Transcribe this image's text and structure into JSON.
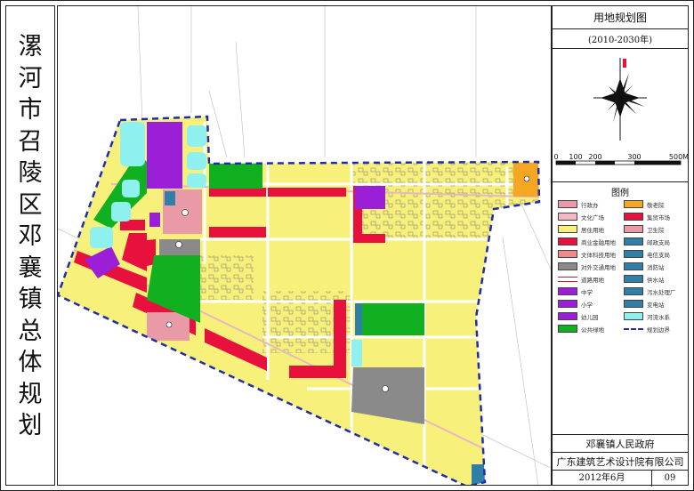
{
  "title_chars": [
    "漯",
    "河",
    "市",
    "召",
    "陵",
    "区",
    "邓",
    "襄",
    "镇",
    "总",
    "体",
    "规",
    "划"
  ],
  "panel": {
    "map_name": "用地规划图",
    "period": "(2010-2030年)",
    "scale_labels": [
      "0",
      "100",
      "200",
      "300",
      "500M"
    ],
    "legend_title": "图例",
    "client": "邓襄镇人民政府",
    "designer": "广东建筑艺术设计院有限公司",
    "date": "2012年6月",
    "sheet_no": "09"
  },
  "legend": [
    {
      "label": "行政办",
      "color": "#e89aa6",
      "icon": "star-icon"
    },
    {
      "label": "文化广场",
      "color": "#f2b8c4",
      "icon": "culture-icon"
    },
    {
      "label": "居住用地",
      "color": "#f7f07a",
      "icon": "none"
    },
    {
      "label": "商业金融用地",
      "color": "#e8103c",
      "icon": "none"
    },
    {
      "label": "文体科技用地",
      "color": "#f08a8a",
      "icon": "none"
    },
    {
      "label": "对外交通用地",
      "color": "#8a8a8a",
      "icon": "bus-icon"
    },
    {
      "label": "道路用地",
      "color": "#ffffff",
      "icon": "road-icon"
    },
    {
      "label": "中学",
      "color": "#9a1fd6",
      "icon": "none"
    },
    {
      "label": "小学",
      "color": "#9a1fd6",
      "icon": "none"
    },
    {
      "label": "幼儿园",
      "color": "#9a1fd6",
      "icon": "none"
    },
    {
      "label": "公共绿地",
      "color": "#10b020",
      "icon": "none"
    },
    {
      "label": "敬老院",
      "color": "#f5a623",
      "icon": "none"
    },
    {
      "label": "集贸市场",
      "color": "#e8103c",
      "icon": "none"
    },
    {
      "label": "卫生院",
      "color": "#e89aa6",
      "icon": "none"
    },
    {
      "label": "邮政支局",
      "color": "#2f7fa8",
      "icon": "none"
    },
    {
      "label": "电信支局",
      "color": "#2f7fa8",
      "icon": "none"
    },
    {
      "label": "消防站",
      "color": "#2f7fa8",
      "icon": "none"
    },
    {
      "label": "供水站",
      "color": "#2f7fa8",
      "icon": "none"
    },
    {
      "label": "污水处理厂",
      "color": "#2f7fa8",
      "icon": "none"
    },
    {
      "label": "变电站",
      "color": "#2f7fa8",
      "icon": "none"
    },
    {
      "label": "河流水系",
      "color": "#8ff0f0",
      "icon": "none"
    },
    {
      "label": "规划边界",
      "color": "#1f2ea6",
      "icon": "dashed-line"
    }
  ],
  "map": {
    "colors": {
      "residential": "#f7f07a",
      "commercial": "#e8103c",
      "school": "#9a1fd6",
      "green": "#10b020",
      "transport": "#8a8a8a",
      "admin": "#e89aa6",
      "utility": "#2f7fa8",
      "water": "#8ff0f0",
      "elderly": "#f5a623",
      "boundary": "#1f2ea6"
    }
  }
}
